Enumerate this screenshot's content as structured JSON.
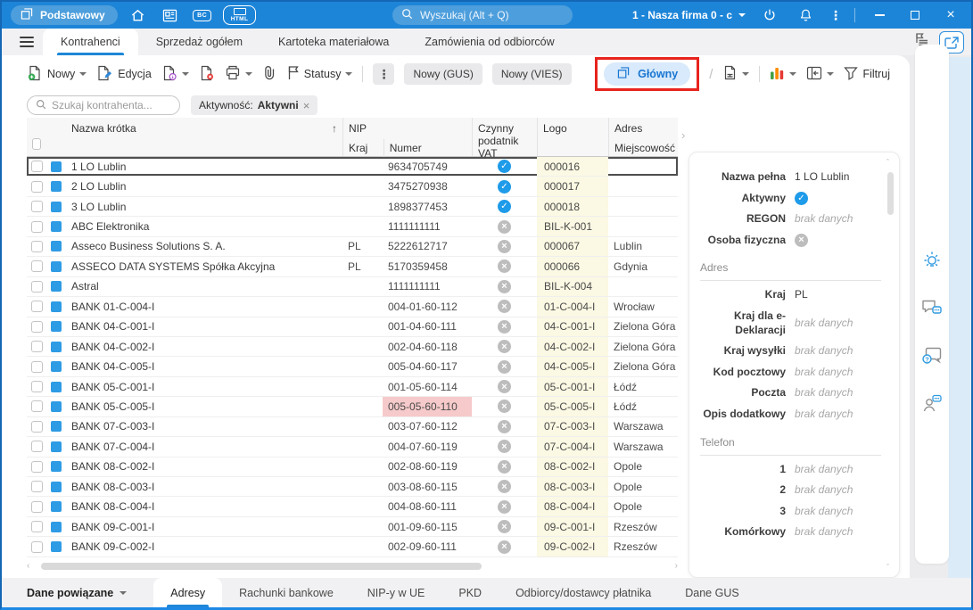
{
  "colors": {
    "titlebar_blue": "#1d85d8",
    "accent_blue": "#1e87d8",
    "check_blue": "#1e9be9",
    "logo_column_bg": "#fbf8e3",
    "nip_alert_bg": "#f6caca",
    "annotation_red": "#e8231d",
    "glowny_pill_bg": "#d8eafb",
    "right_edge_blue": "#dcebf8"
  },
  "titlebar": {
    "workspace": "Podstawowy",
    "bc_badge": "BC",
    "html_badge": "HTML",
    "search_placeholder": "Wyszukaj (Alt + Q)",
    "company": "1 - Nasza firma 0 - c"
  },
  "tabs": {
    "items": [
      {
        "label": "Kontrahenci",
        "active": true
      },
      {
        "label": "Sprzedaż ogółem",
        "active": false
      },
      {
        "label": "Kartoteka materiałowa",
        "active": false
      },
      {
        "label": "Zamówienia od odbiorców",
        "active": false
      }
    ]
  },
  "toolbar": {
    "nowy": "Nowy",
    "edycja": "Edycja",
    "statusy": "Statusy",
    "nowy_gus": "Nowy (GUS)",
    "nowy_vies": "Nowy (VIES)",
    "glowny": "Główny",
    "divider_slash": "/",
    "filtruj": "Filtruj"
  },
  "filter_row": {
    "search_placeholder": "Szukaj kontrahenta...",
    "chip_label": "Aktywność:",
    "chip_value": "Aktywni"
  },
  "table": {
    "headers": {
      "name": "Nazwa krótka",
      "nip_group": "NIP",
      "kraj": "Kraj",
      "numer": "Numer",
      "vat": "Czynny podatnik VAT",
      "logo": "Logo",
      "adres_group": "Adres",
      "miejscowosc": "Miejscowość"
    },
    "rows": [
      {
        "name": "1 LO Lublin",
        "kraj": "",
        "nip": "9634705749",
        "vat": true,
        "logo": "000016",
        "city": "",
        "selected": true
      },
      {
        "name": "2 LO Lublin",
        "kraj": "",
        "nip": "3475270938",
        "vat": true,
        "logo": "000017",
        "city": ""
      },
      {
        "name": "3 LO Lublin",
        "kraj": "",
        "nip": "1898377453",
        "vat": true,
        "logo": "000018",
        "city": ""
      },
      {
        "name": "ABC Elektronika",
        "kraj": "",
        "nip": "1111111111",
        "vat": false,
        "logo": "BIL-K-001",
        "city": ""
      },
      {
        "name": "Asseco Business Solutions S. A.",
        "kraj": "PL",
        "nip": "5222612717",
        "vat": false,
        "logo": "000067",
        "city": "Lublin"
      },
      {
        "name": "ASSECO DATA SYSTEMS Spółka Akcyjna",
        "kraj": "PL",
        "nip": "5170359458",
        "vat": false,
        "logo": "000066",
        "city": "Gdynia"
      },
      {
        "name": "Astral",
        "kraj": "",
        "nip": "1111111111",
        "vat": false,
        "logo": "BIL-K-004",
        "city": ""
      },
      {
        "name": "BANK 01-C-004-I",
        "kraj": "",
        "nip": "004-01-60-112",
        "vat": false,
        "logo": "01-C-004-I",
        "city": "Wrocław"
      },
      {
        "name": "BANK 04-C-001-I",
        "kraj": "",
        "nip": "001-04-60-111",
        "vat": false,
        "logo": "04-C-001-I",
        "city": "Zielona Góra"
      },
      {
        "name": "BANK 04-C-002-I",
        "kraj": "",
        "nip": "002-04-60-118",
        "vat": false,
        "logo": "04-C-002-I",
        "city": "Zielona Góra"
      },
      {
        "name": "BANK 04-C-005-I",
        "kraj": "",
        "nip": "005-04-60-117",
        "vat": false,
        "logo": "04-C-005-I",
        "city": "Zielona Góra"
      },
      {
        "name": "BANK 05-C-001-I",
        "kraj": "",
        "nip": "001-05-60-114",
        "vat": false,
        "logo": "05-C-001-I",
        "city": "Łódź"
      },
      {
        "name": "BANK 05-C-005-I",
        "kraj": "",
        "nip": "005-05-60-110",
        "vat": false,
        "logo": "05-C-005-I",
        "city": "Łódź",
        "nip_alert": true
      },
      {
        "name": "BANK 07-C-003-I",
        "kraj": "",
        "nip": "003-07-60-112",
        "vat": false,
        "logo": "07-C-003-I",
        "city": "Warszawa"
      },
      {
        "name": "BANK 07-C-004-I",
        "kraj": "",
        "nip": "004-07-60-119",
        "vat": false,
        "logo": "07-C-004-I",
        "city": "Warszawa"
      },
      {
        "name": "BANK 08-C-002-I",
        "kraj": "",
        "nip": "002-08-60-119",
        "vat": false,
        "logo": "08-C-002-I",
        "city": "Opole"
      },
      {
        "name": "BANK 08-C-003-I",
        "kraj": "",
        "nip": "003-08-60-115",
        "vat": false,
        "logo": "08-C-003-I",
        "city": "Opole"
      },
      {
        "name": "BANK 08-C-004-I",
        "kraj": "",
        "nip": "004-08-60-111",
        "vat": false,
        "logo": "08-C-004-I",
        "city": "Opole"
      },
      {
        "name": "BANK 09-C-001-I",
        "kraj": "",
        "nip": "001-09-60-115",
        "vat": false,
        "logo": "09-C-001-I",
        "city": "Rzeszów"
      },
      {
        "name": "BANK 09-C-002-I",
        "kraj": "",
        "nip": "002-09-60-111",
        "vat": false,
        "logo": "09-C-002-I",
        "city": "Rzeszów"
      }
    ]
  },
  "detail_panel": {
    "sections": [
      {
        "title": "",
        "fields": [
          {
            "label": "Nazwa pełna",
            "value": "1 LO Lublin",
            "kind": "text"
          },
          {
            "label": "Aktywny",
            "kind": "check"
          },
          {
            "label": "REGON",
            "value": "brak danych",
            "kind": "empty"
          },
          {
            "label": "Osoba fizyczna",
            "kind": "cross"
          }
        ]
      },
      {
        "title": "Adres",
        "fields": [
          {
            "label": "Kraj",
            "value": "PL",
            "kind": "text"
          },
          {
            "label": "Kraj dla e-Deklaracji",
            "value": "brak danych",
            "kind": "empty"
          },
          {
            "label": "Kraj wysyłki",
            "value": "brak danych",
            "kind": "empty"
          },
          {
            "label": "Kod pocztowy",
            "value": "brak danych",
            "kind": "empty"
          },
          {
            "label": "Poczta",
            "value": "brak danych",
            "kind": "empty"
          },
          {
            "label": "Opis dodatkowy",
            "value": "brak danych",
            "kind": "empty"
          }
        ]
      },
      {
        "title": "Telefon",
        "fields": [
          {
            "label": "1",
            "value": "brak danych",
            "kind": "empty"
          },
          {
            "label": "2",
            "value": "brak danych",
            "kind": "empty"
          },
          {
            "label": "3",
            "value": "brak danych",
            "kind": "empty"
          },
          {
            "label": "Komórkowy",
            "value": "brak danych",
            "kind": "empty"
          }
        ]
      }
    ]
  },
  "bottom_bar": {
    "menu_label": "Dane powiązane",
    "tabs": [
      {
        "label": "Adresy",
        "active": true
      },
      {
        "label": "Rachunki bankowe",
        "active": false
      },
      {
        "label": "NIP-y w UE",
        "active": false
      },
      {
        "label": "PKD",
        "active": false
      },
      {
        "label": "Odbiorcy/dostawcy płatnika",
        "active": false
      },
      {
        "label": "Dane GUS",
        "active": false
      }
    ]
  }
}
